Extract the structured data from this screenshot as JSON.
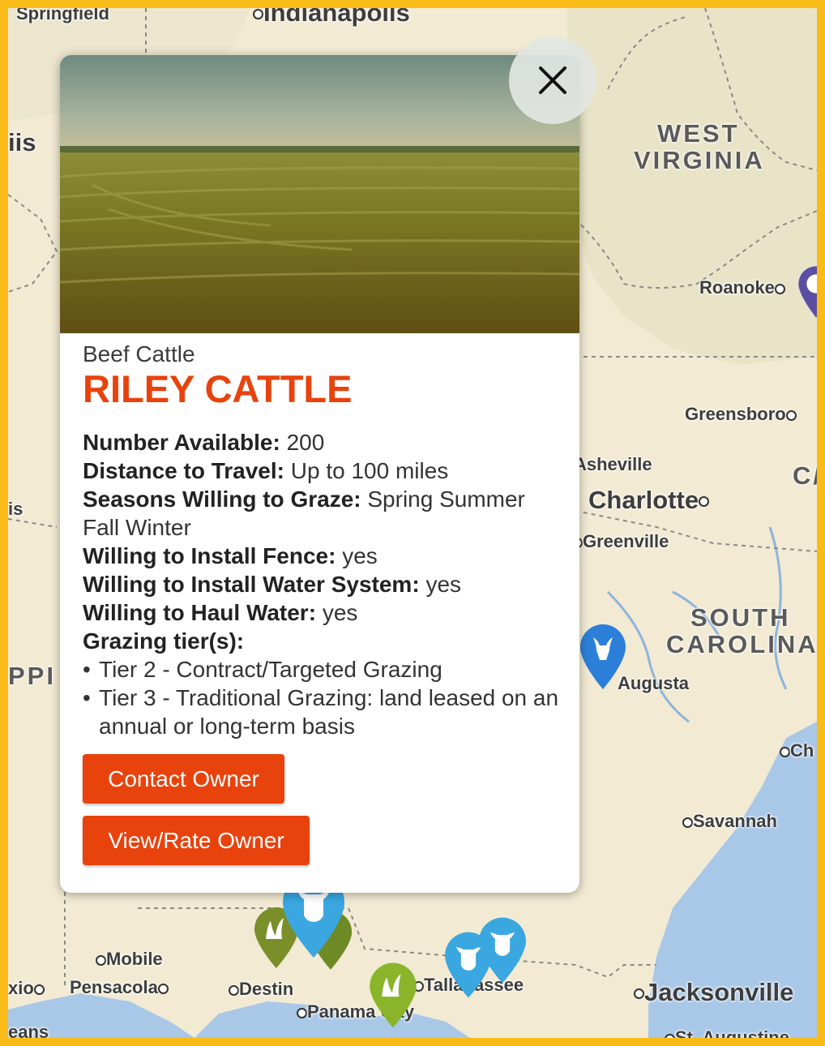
{
  "map": {
    "states": {
      "west_virginia_line1": "WEST",
      "west_virginia_line2": "VIRGINIA",
      "south_carolina_line1": "SOUTH",
      "south_carolina_line2": "CAROLINA",
      "mississippi_partial": "PPI",
      "carolina_partial": "C/"
    },
    "cities": {
      "indianapolis": "Indianapolis",
      "springfield_partial": "Springfield",
      "illinois_partial": "iis",
      "is_partial": "is",
      "roanoke": "Roanoke",
      "greensboro": "Greensboro",
      "asheville": "Asheville",
      "charlotte": "Charlotte",
      "greenville": "Greenville",
      "augusta": "Augusta",
      "charleston_partial": "Ch",
      "savannah": "Savannah",
      "mobile": "Mobile",
      "pensacola": "Pensacola",
      "destin": "Destin",
      "panama_city": "Panama City",
      "tallahassee": "Tallahassee",
      "jacksonville": "Jacksonville",
      "st_augustine": "St. Augustine",
      "orleans_partial": "eans",
      "mexico_partial": "xio"
    }
  },
  "popup": {
    "category": "Beef Cattle",
    "title": "RILEY CATTLE",
    "details": [
      {
        "label": "Number Available:",
        "value": "200"
      },
      {
        "label": "Distance to Travel:",
        "value": "Up to 100 miles"
      },
      {
        "label": "Seasons Willing to Graze:",
        "value": "Spring Summer Fall Winter"
      },
      {
        "label": "Willing to Install Fence:",
        "value": "yes"
      },
      {
        "label": "Willing to Install Water System:",
        "value": "yes"
      },
      {
        "label": "Willing to Haul Water:",
        "value": "yes"
      }
    ],
    "tiers_label": "Grazing tier(s):",
    "tiers": [
      "Tier 2 - Contract/Targeted Grazing",
      "Tier 3 - Traditional Grazing: land leased on an annual or long-term basis"
    ],
    "contact_button": "Contact Owner",
    "view_rate_button": "View/Rate Owner"
  },
  "colors": {
    "frame": "#f8bb17",
    "accent": "#e8420d",
    "marker_blue": "#3aa7e0",
    "marker_green": "#7ea428",
    "marker_goat_blue": "#2b7fd8",
    "marker_purple": "#5a4fa3"
  }
}
